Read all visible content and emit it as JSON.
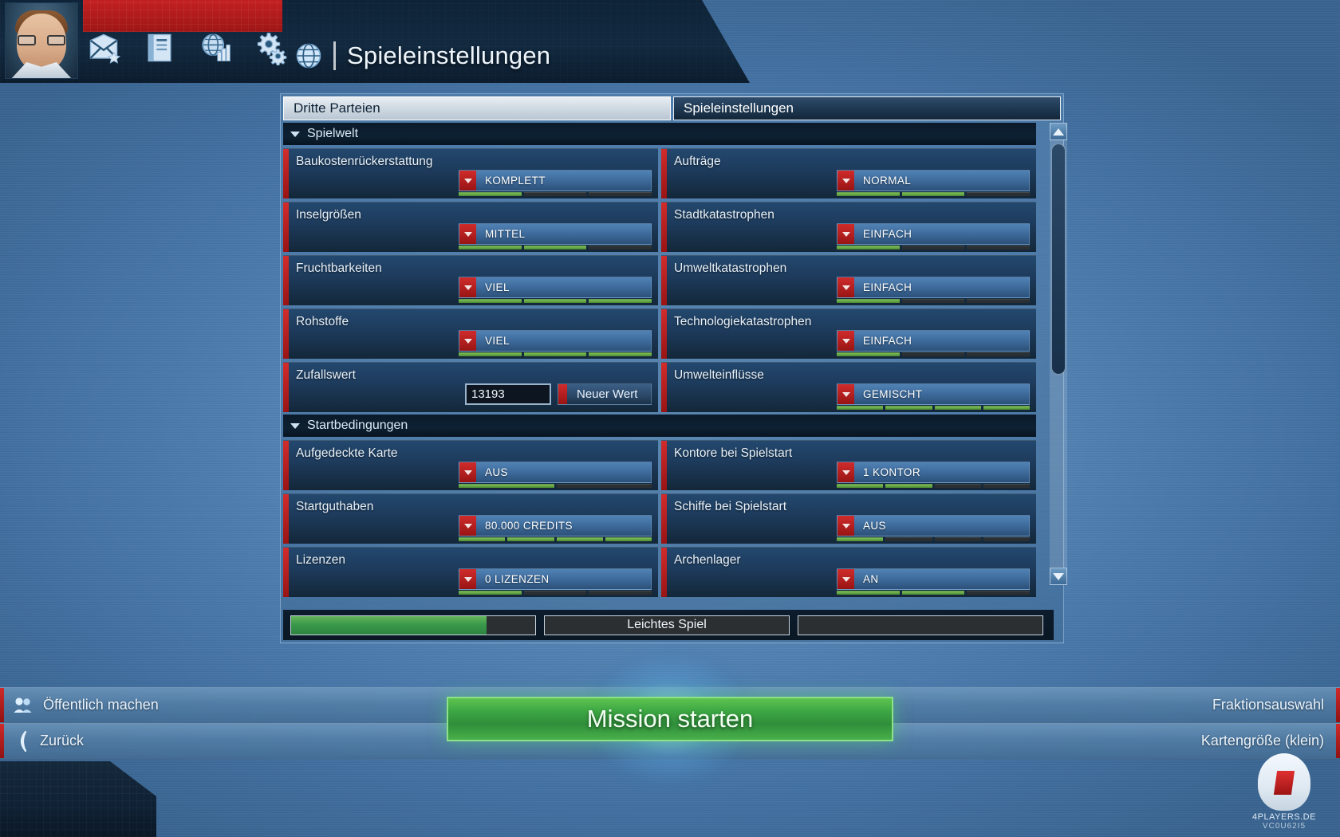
{
  "header": {
    "title": "Spieleinstellungen",
    "globe_icon": "globe-icon",
    "nav_icons": [
      {
        "name": "mail-icon",
        "label": "Nachrichten"
      },
      {
        "name": "book-icon",
        "label": "Logbuch"
      },
      {
        "name": "globe-stats-icon",
        "label": "Statistiken"
      },
      {
        "name": "gear-icon",
        "label": "Optionen"
      }
    ]
  },
  "tabs": [
    {
      "label": "Dritte Parteien",
      "active": false
    },
    {
      "label": "Spieleinstellungen",
      "active": true
    }
  ],
  "sections": [
    {
      "title": "Spielwelt",
      "rows": [
        {
          "left": {
            "caption": "Baukostenrückerstattung",
            "value": "KOMPLETT",
            "segments": 3,
            "filled": 1
          },
          "right": {
            "caption": "Aufträge",
            "value": "NORMAL",
            "segments": 3,
            "filled": 2
          }
        },
        {
          "left": {
            "caption": "Inselgrößen",
            "value": "MITTEL",
            "segments": 3,
            "filled": 2
          },
          "right": {
            "caption": "Stadtkatastrophen",
            "value": "EINFACH",
            "segments": 3,
            "filled": 1
          }
        },
        {
          "left": {
            "caption": "Fruchtbarkeiten",
            "value": "VIEL",
            "segments": 3,
            "filled": 3
          },
          "right": {
            "caption": "Umweltkatastrophen",
            "value": "EINFACH",
            "segments": 3,
            "filled": 1
          }
        },
        {
          "left": {
            "caption": "Rohstoffe",
            "value": "VIEL",
            "segments": 3,
            "filled": 3
          },
          "right": {
            "caption": "Technologiekatastrophen",
            "value": "EINFACH",
            "segments": 3,
            "filled": 1
          }
        },
        {
          "left": {
            "caption": "Zufallswert",
            "type": "seed",
            "seed_value": "13193",
            "seed_button": "Neuer Wert"
          },
          "right": {
            "caption": "Umwelteinflüsse",
            "value": "GEMISCHT",
            "segments": 4,
            "filled": 4
          }
        }
      ]
    },
    {
      "title": "Startbedingungen",
      "rows": [
        {
          "left": {
            "caption": "Aufgedeckte Karte",
            "value": "AUS",
            "segments": 2,
            "filled": 1
          },
          "right": {
            "caption": "Kontore bei Spielstart",
            "value": "1 KONTOR",
            "segments": 4,
            "filled": 2
          }
        },
        {
          "left": {
            "caption": "Startguthaben",
            "value": "80.000 CREDITS",
            "segments": 4,
            "filled": 4
          },
          "right": {
            "caption": "Schiffe bei Spielstart",
            "value": "AUS",
            "segments": 4,
            "filled": 1
          }
        },
        {
          "left": {
            "caption": "Lizenzen",
            "value": "0 LIZENZEN",
            "segments": 3,
            "filled": 1
          },
          "right": {
            "caption": "Archenlager",
            "value": "AN",
            "segments": 3,
            "filled": 2
          }
        }
      ]
    }
  ],
  "difficulty": {
    "percent": 80,
    "label": "Leichtes Spiel",
    "extra": ""
  },
  "bottom": {
    "public_label": "Öffentlich machen",
    "public_icon": "people-icon",
    "back_label": "Zurück",
    "back_icon": "chevron-left-icon",
    "faction_label": "Fraktionsauswahl",
    "mapsize_label": "Kartengröße (klein)",
    "mission_label": "Mission starten"
  },
  "tray": {
    "icons": [
      {
        "name": "friends-icon"
      },
      {
        "name": "globe-chat-icon"
      }
    ]
  },
  "watermark": {
    "brand": "4PLAYERS.DE",
    "code": "VC0U62I5"
  },
  "colors": {
    "accent_red": "#d02b2b",
    "green": "#3ea844",
    "panel_dark": "#1d3a5b",
    "text_light": "#eaf3fb"
  }
}
